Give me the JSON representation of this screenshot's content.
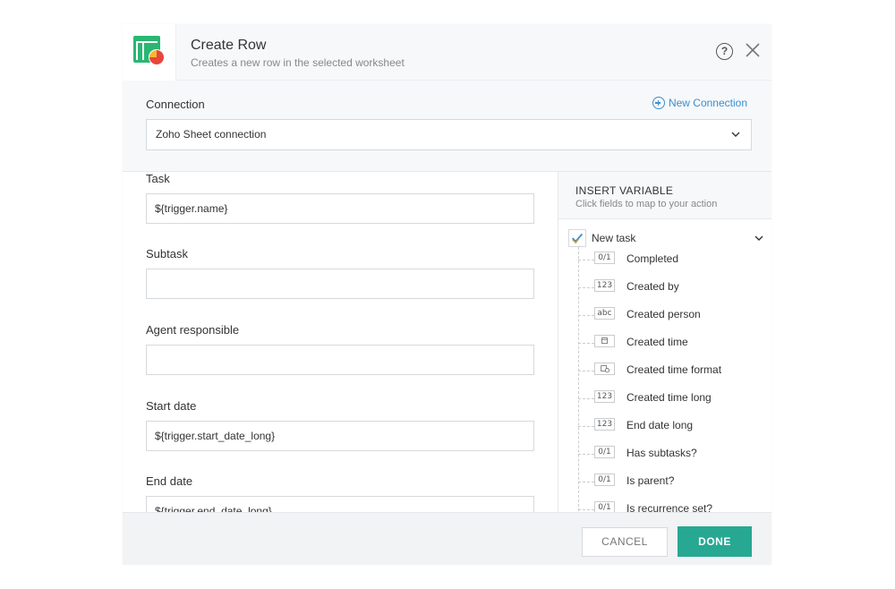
{
  "header": {
    "title": "Create Row",
    "subtitle": "Creates a new row in the selected worksheet",
    "help_label": "?"
  },
  "connection": {
    "label": "Connection",
    "new_connection_label": "New Connection",
    "selected": "Zoho Sheet connection"
  },
  "fields": [
    {
      "label": "Task",
      "value": "${trigger.name}"
    },
    {
      "label": "Subtask",
      "value": ""
    },
    {
      "label": "Agent responsible",
      "value": ""
    },
    {
      "label": "Start date",
      "value": "${trigger.start_date_long}"
    },
    {
      "label": "End date",
      "value": "${trigger.end_date_long}"
    }
  ],
  "variables": {
    "title": "INSERT VARIABLE",
    "subtitle": "Click fields to map to your action",
    "group_label": "New task",
    "items": [
      {
        "type": "0/1",
        "name": "Completed"
      },
      {
        "type": "123",
        "name": "Created by"
      },
      {
        "type": "abc",
        "name": "Created person"
      },
      {
        "type": "",
        "name": "Created time"
      },
      {
        "type": "",
        "name": "Created time format"
      },
      {
        "type": "123",
        "name": "Created time long"
      },
      {
        "type": "123",
        "name": "End date long"
      },
      {
        "type": "0/1",
        "name": "Has subtasks?"
      },
      {
        "type": "0/1",
        "name": "Is parent?"
      },
      {
        "type": "0/1",
        "name": "Is recurrence set?"
      }
    ]
  },
  "footer": {
    "cancel_label": "CANCEL",
    "done_label": "DONE"
  },
  "colors": {
    "accent": "#27a893",
    "link": "#3a8fd0",
    "icon_green": "#2bb673",
    "icon_red": "#e8453c"
  }
}
